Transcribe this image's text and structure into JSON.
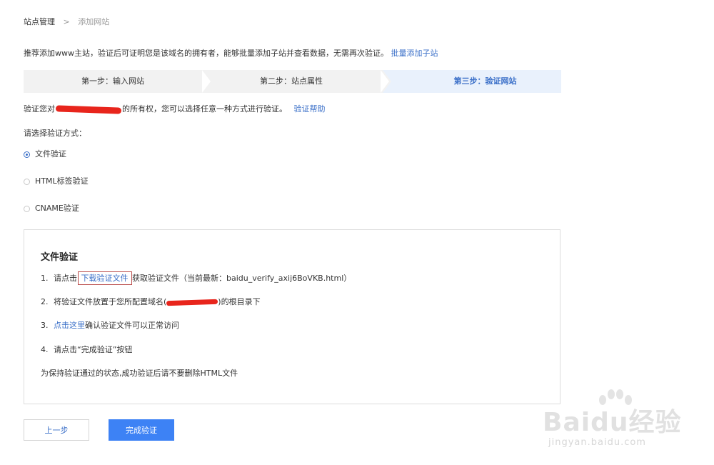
{
  "breadcrumb": {
    "root": "站点管理",
    "separator": ">",
    "current": "添加网站"
  },
  "intro": {
    "text": "推荐添加www主站，验证后可证明您是该域名的拥有者，能够批量添加子站并查看数据，无需再次验证。",
    "link": "批量添加子站"
  },
  "steps": [
    {
      "label": "第一步：输入网站"
    },
    {
      "label": "第二步：站点属性"
    },
    {
      "label": "第三步：验证网站"
    }
  ],
  "verify": {
    "prefix": "验证您对",
    "suffix": "的所有权，您可以选择任意一种方式进行验证。",
    "help_link": "验证帮助"
  },
  "choose_label": "请选择验证方式：",
  "methods": [
    {
      "label": "文件验证",
      "selected": true
    },
    {
      "label": "HTML标签验证",
      "selected": false
    },
    {
      "label": "CNAME验证",
      "selected": false
    }
  ],
  "panel": {
    "title": "文件验证",
    "line1": {
      "num": "1.",
      "pre": "请点击",
      "link": "下载验证文件",
      "post": "获取验证文件（当前最新：baidu_verify_axij6BoVKB.html）"
    },
    "line2": {
      "num": "2.",
      "pre": "将验证文件放置于您所配置域名(",
      "post": ")的根目录下"
    },
    "line3": {
      "num": "3.",
      "link": "点击这里",
      "post": "确认验证文件可以正常访问"
    },
    "line4": {
      "num": "4.",
      "text": "请点击“完成验证”按钮"
    },
    "note": "为保持验证通过的状态,成功验证后请不要删除HTML文件"
  },
  "buttons": {
    "prev": "上一步",
    "done": "完成验证"
  },
  "watermark": {
    "big": "Baidu经验",
    "small": "jingyan.baidu.com"
  },
  "colors": {
    "accent": "#3a6fc8",
    "primary_button": "#3d82f5",
    "active_step_bg": "#e9f1fc",
    "step_bg": "#f2f2f2"
  }
}
